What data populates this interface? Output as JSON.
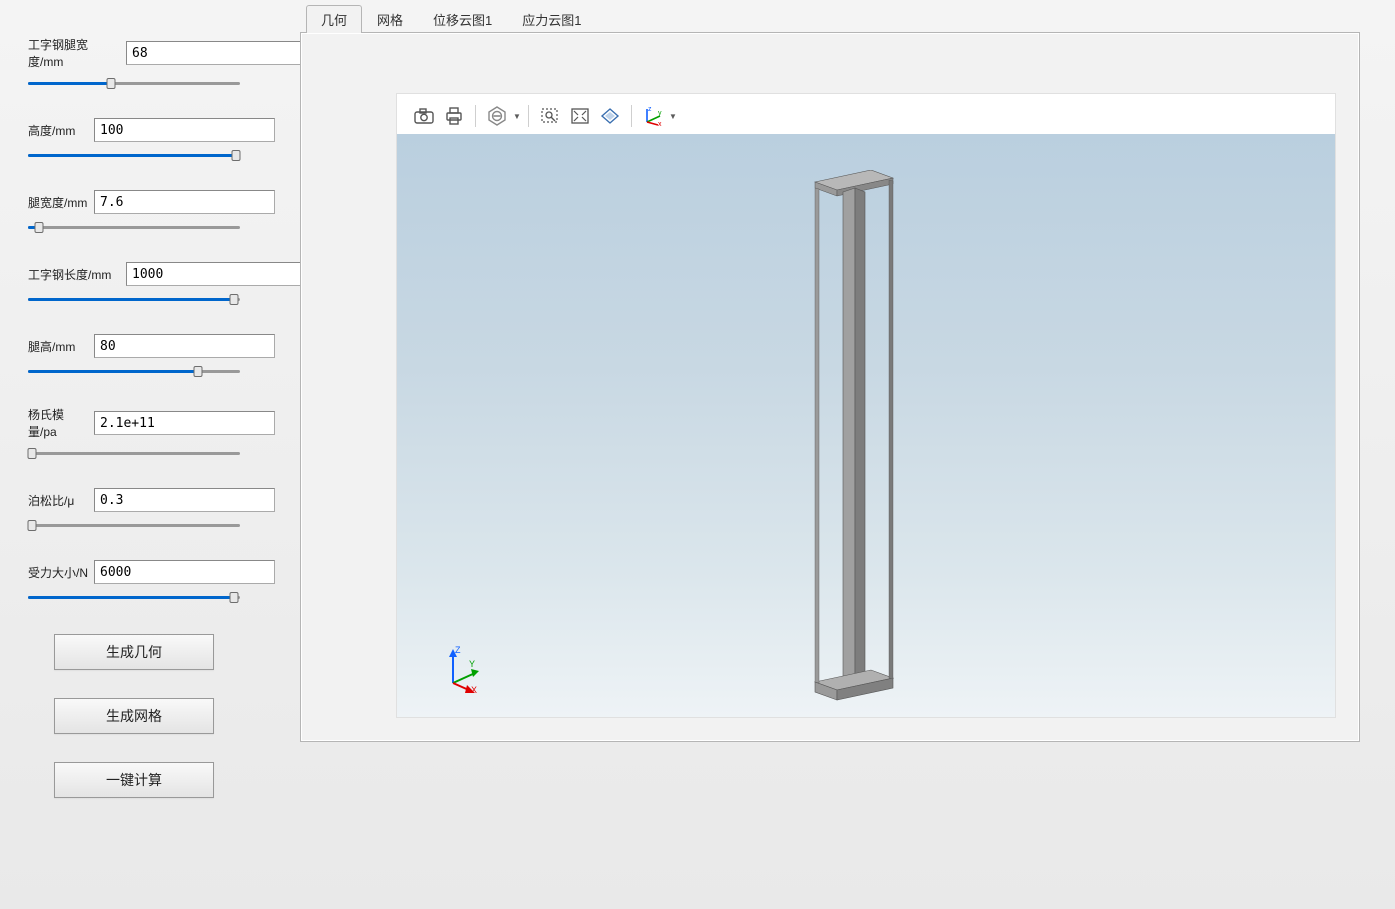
{
  "sidebar": {
    "params": [
      {
        "label": "工字钢腿宽度/mm",
        "value": "68",
        "wide": true,
        "fill": 39
      },
      {
        "label": "高度/mm",
        "value": "100",
        "wide": false,
        "fill": 98
      },
      {
        "label": "腿宽度/mm",
        "value": "7.6",
        "wide": false,
        "fill": 5
      },
      {
        "label": "工字钢长度/mm",
        "value": "1000",
        "wide": true,
        "fill": 97
      },
      {
        "label": "腿高/mm",
        "value": "80",
        "wide": false,
        "fill": 80
      },
      {
        "label": "杨氏模量/pa",
        "value": "2.1e+11",
        "wide": false,
        "fill": 2
      },
      {
        "label": "泊松比/μ",
        "value": "0.3",
        "wide": false,
        "fill": 2
      },
      {
        "label": "受力大小/N",
        "value": "6000",
        "wide": false,
        "fill": 97
      }
    ],
    "buttons": {
      "generate_geometry": "生成几何",
      "generate_mesh": "生成网格",
      "one_click_calc": "一键计算"
    }
  },
  "tabs": {
    "items": [
      {
        "label": "几何",
        "active": true
      },
      {
        "label": "网格",
        "active": false
      },
      {
        "label": "位移云图1",
        "active": false
      },
      {
        "label": "应力云图1",
        "active": false
      }
    ]
  },
  "toolbar": {
    "items": [
      "camera",
      "print",
      "sep",
      "no-entry",
      "sep",
      "zoom-select",
      "zoom-extents",
      "reset-view",
      "sep",
      "axes-toggle"
    ]
  },
  "axis": {
    "x": "X",
    "y": "Y",
    "z": "Z"
  }
}
